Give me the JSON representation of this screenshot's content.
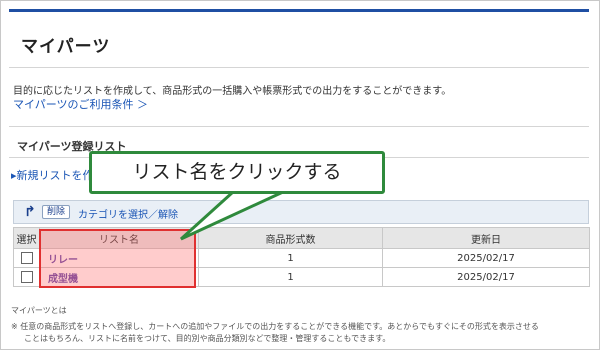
{
  "page": {
    "title": "マイパーツ",
    "description": "目的に応じたリストを作成して、商品形式の一括購入や帳票形式での出力をすることができます。",
    "terms_link": "マイパーツのご利用条件 ＞"
  },
  "section": {
    "title": "マイパーツ登録リスト",
    "new_list": "▸新規リストを作"
  },
  "toolbar": {
    "arrow_icon": "↱",
    "delete_label": "削除",
    "category_link": "カテゴリを選択／解除"
  },
  "table": {
    "headers": {
      "select": "選択",
      "list_name": "リスト名",
      "format_count": "商品形式数",
      "updated": "更新日"
    },
    "rows": [
      {
        "name": "リレー",
        "count": "1",
        "date": "2025/02/17"
      },
      {
        "name": "成型機",
        "count": "1",
        "date": "2025/02/17"
      }
    ]
  },
  "callout": {
    "text": "リスト名をクリックする",
    "border_color": "#2f8a3c"
  },
  "highlight": {
    "color": "#e03030"
  },
  "footer": {
    "about": "マイパーツとは",
    "note_line1": "※ 任意の商品形式をリストへ登録し、カートへの追加やファイルでの出力をすることができる機能です。あとからでもすぐにその形式を表示させる",
    "note_line2": "ことはもちろん、リストに名前をつけて、目的別や商品分類別などで整理・管理することもできます。"
  },
  "colors": {
    "accent": "#1f4fa3",
    "link": "#1a55b5",
    "list_link": "#5b3fa8"
  }
}
